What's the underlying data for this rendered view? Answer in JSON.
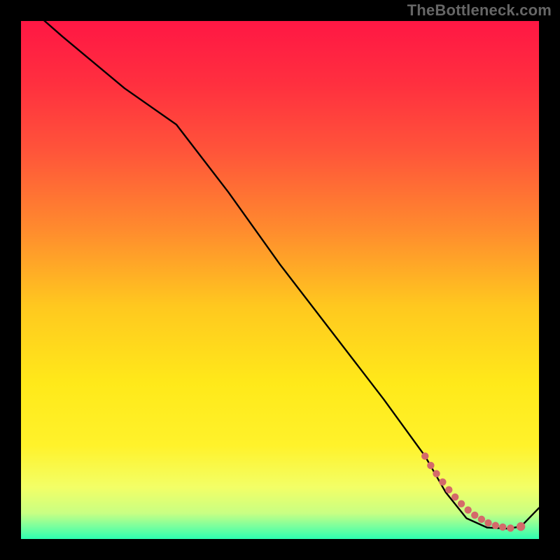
{
  "watermark": "TheBottleneck.com",
  "chart_data": {
    "type": "line",
    "title": "",
    "xlabel": "",
    "ylabel": "",
    "xlim": [
      0,
      100
    ],
    "ylim": [
      0,
      100
    ],
    "gradient_stops": [
      {
        "offset": 0.0,
        "color": "#ff1744"
      },
      {
        "offset": 0.12,
        "color": "#ff2f3f"
      },
      {
        "offset": 0.25,
        "color": "#ff543a"
      },
      {
        "offset": 0.4,
        "color": "#ff8a2e"
      },
      {
        "offset": 0.55,
        "color": "#ffc81f"
      },
      {
        "offset": 0.7,
        "color": "#ffe91a"
      },
      {
        "offset": 0.82,
        "color": "#fff22b"
      },
      {
        "offset": 0.9,
        "color": "#f3ff66"
      },
      {
        "offset": 0.95,
        "color": "#c9ff83"
      },
      {
        "offset": 0.975,
        "color": "#7cff9d"
      },
      {
        "offset": 1.0,
        "color": "#2dffb0"
      }
    ],
    "series": [
      {
        "name": "bottleneck-curve",
        "x": [
          0,
          8,
          20,
          30,
          40,
          50,
          60,
          70,
          78,
          82,
          86,
          90,
          94,
          96.5,
          100
        ],
        "y": [
          104,
          97,
          87,
          80,
          67,
          53,
          40,
          27,
          16,
          9,
          4,
          2.2,
          2.0,
          2.4,
          6
        ]
      }
    ],
    "markers": {
      "name": "highlight-segment",
      "x": [
        78.0,
        79.1,
        80.2,
        81.4,
        82.6,
        83.8,
        85.0,
        86.3,
        87.6,
        88.9,
        90.2,
        91.6,
        93.0,
        94.5,
        96.5
      ],
      "y": [
        16.0,
        14.2,
        12.6,
        11.0,
        9.5,
        8.1,
        6.8,
        5.6,
        4.6,
        3.8,
        3.1,
        2.6,
        2.3,
        2.1,
        2.4
      ]
    },
    "marker_color": "#d46a6a",
    "marker_radius_main": 5.2,
    "marker_radius_end": 6.2
  }
}
